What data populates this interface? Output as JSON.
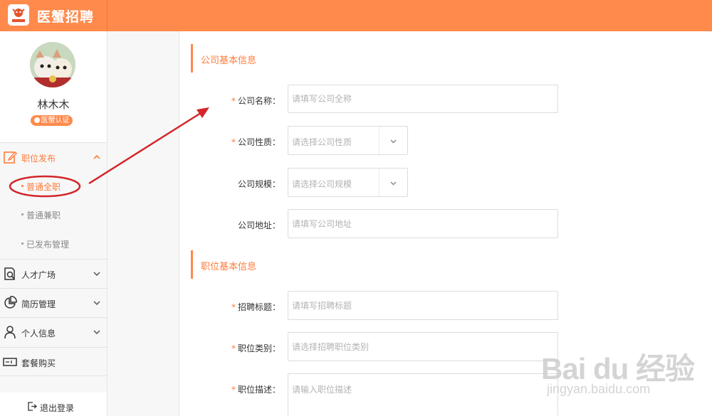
{
  "header": {
    "brand": "医蟹招聘",
    "logo_icon": "crab-logo-icon",
    "accent_color": "#ff8a4c"
  },
  "sidebar": {
    "profile": {
      "name": "林木木",
      "badge": "医蟹认证"
    },
    "nav": [
      {
        "label": "职位发布",
        "icon": "edit-icon",
        "expanded": true,
        "children": [
          {
            "label": "普通全职",
            "current": true
          },
          {
            "label": "普通兼职",
            "current": false
          },
          {
            "label": "已发布管理",
            "current": false
          }
        ]
      },
      {
        "label": "人才广场",
        "icon": "resume-search-icon",
        "expanded": false
      },
      {
        "label": "简历管理",
        "icon": "pie-chart-icon",
        "expanded": false
      },
      {
        "label": "个人信息",
        "icon": "user-icon",
        "expanded": false
      },
      {
        "label": "套餐购买",
        "icon": "ticket-icon",
        "expanded": false
      }
    ],
    "logout_label": "退出登录"
  },
  "sections": {
    "company": {
      "title": "公司基本信息",
      "fields": {
        "name": {
          "label": "公司名称：",
          "required": true,
          "placeholder": "请填写公司全称"
        },
        "nature": {
          "label": "公司性质：",
          "required": true,
          "placeholder": "请选择公司性质"
        },
        "scale": {
          "label": "公司规模：",
          "required": false,
          "placeholder": "请选择公司规模"
        },
        "address": {
          "label": "公司地址：",
          "required": false,
          "placeholder": "请填写公司地址"
        }
      }
    },
    "job": {
      "title": "职位基本信息",
      "fields": {
        "title": {
          "label": "招聘标题：",
          "required": true,
          "placeholder": "请填写招聘标题"
        },
        "category": {
          "label": "职位类别：",
          "required": true,
          "placeholder": "请选择招聘职位类别"
        },
        "description": {
          "label": "职位描述：",
          "required": true,
          "placeholder": "请输入职位描述"
        }
      }
    }
  },
  "required_mark": "*",
  "watermark": {
    "logo": "Bai du 经验",
    "url": "jingyan.baidu.com"
  }
}
